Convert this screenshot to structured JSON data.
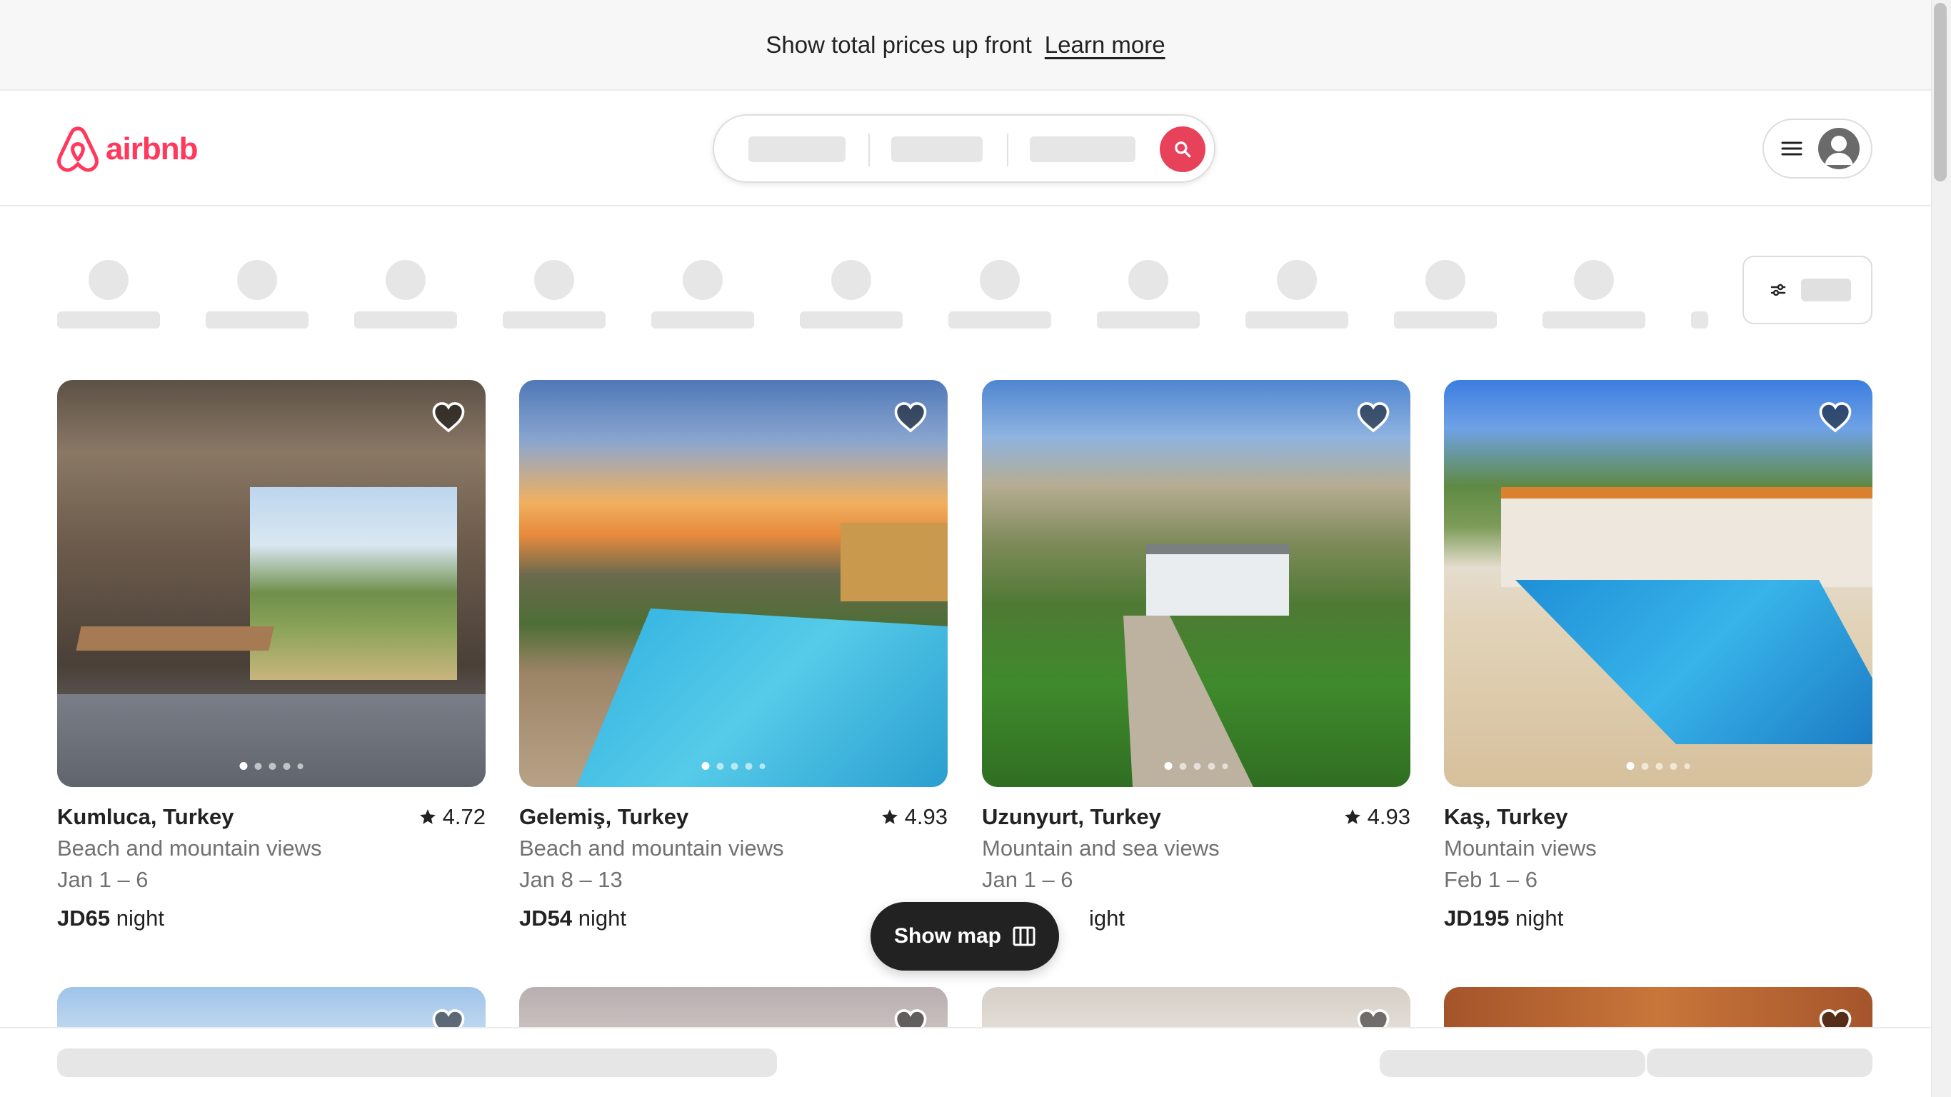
{
  "banner": {
    "message": "Show total prices up front",
    "link": "Learn more"
  },
  "brand": {
    "name": "airbnb",
    "color": "#ff385c"
  },
  "header": {
    "search_icon": "search-icon",
    "menu_icon": "hamburger-icon",
    "avatar_icon": "user-avatar-icon"
  },
  "filters": {
    "icon": "filters-icon"
  },
  "listings": [
    {
      "location": "Kumluca, Turkey",
      "rating": "4.72",
      "description": "Beach and mountain views",
      "dates": "Jan 1 – 6",
      "price": "JD65",
      "price_unit": " night",
      "photo_count": 5,
      "active_photo": 1
    },
    {
      "location": "Gelemiş, Turkey",
      "rating": "4.93",
      "description": "Beach and mountain views",
      "dates": "Jan 8 – 13",
      "price": "JD54",
      "price_unit": " night",
      "photo_count": 5,
      "active_photo": 1
    },
    {
      "location": "Uzunyurt, Turkey",
      "rating": "4.93",
      "description": "Mountain and sea views",
      "dates": "Jan 1 – 6",
      "price": "",
      "price_unit": "ight",
      "photo_count": 5,
      "active_photo": 1
    },
    {
      "location": "Kaş, Turkey",
      "rating": "",
      "description": "Mountain views",
      "dates": "Feb 1 – 6",
      "price": "JD195",
      "price_unit": " night",
      "photo_count": 5,
      "active_photo": 1
    }
  ],
  "show_map": {
    "label": "Show map",
    "icon": "map-icon"
  },
  "colors": {
    "accent": "#ff385c",
    "search_button": "#e8415a",
    "text": "#222222",
    "muted_text": "#717171",
    "skeleton": "#e6e6e6"
  }
}
